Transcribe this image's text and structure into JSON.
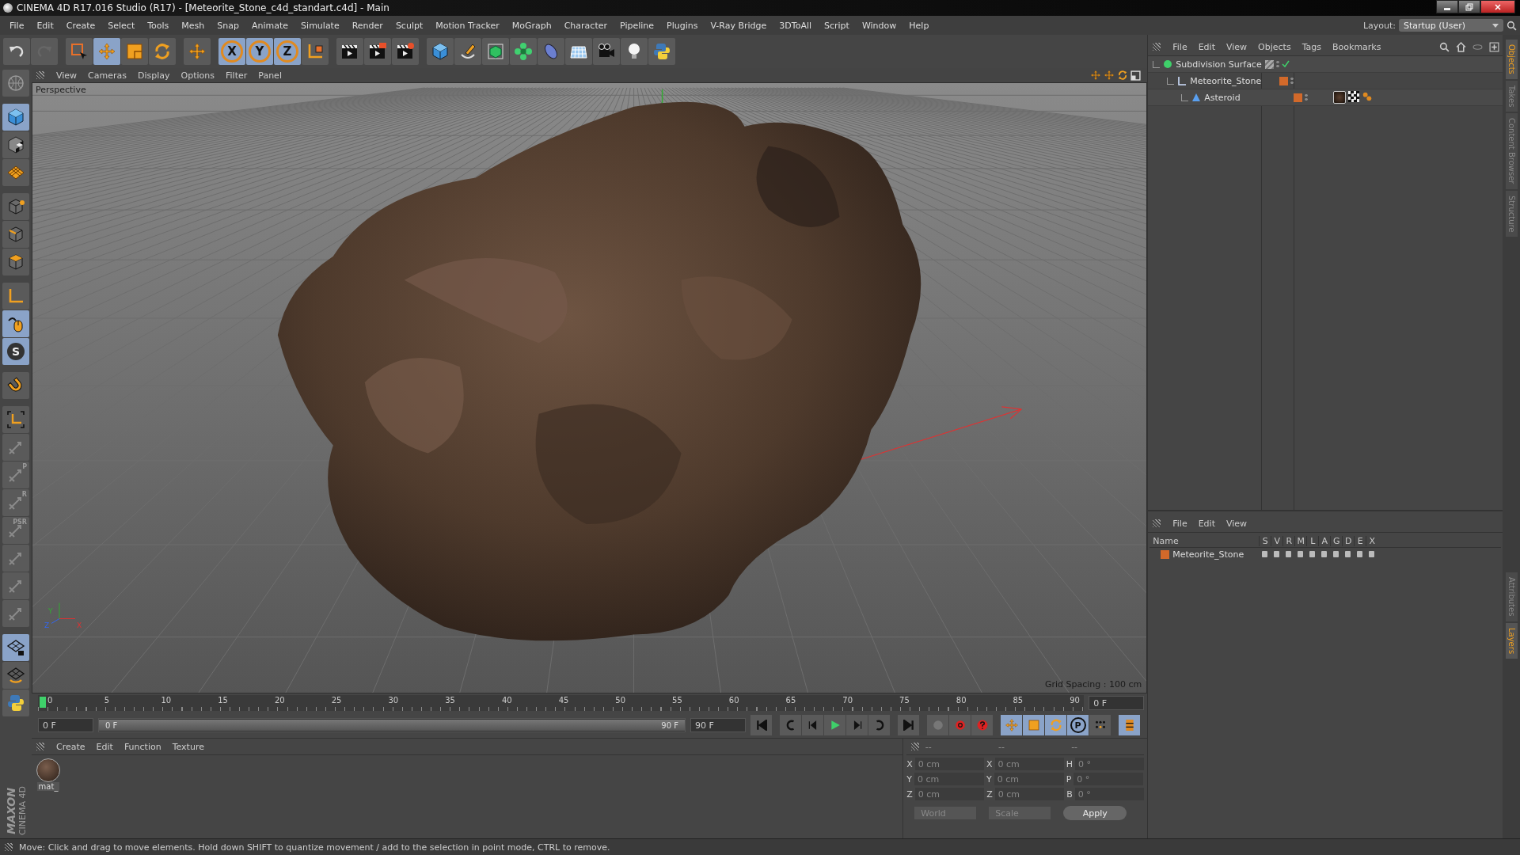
{
  "window": {
    "title": "CINEMA 4D R17.016 Studio (R17) - [Meteorite_Stone_c4d_standart.c4d] - Main"
  },
  "menu": [
    "File",
    "Edit",
    "Create",
    "Select",
    "Tools",
    "Mesh",
    "Snap",
    "Animate",
    "Simulate",
    "Render",
    "Sculpt",
    "Motion Tracker",
    "MoGraph",
    "Character",
    "Pipeline",
    "Plugins",
    "V-Ray Bridge",
    "3DToAll",
    "Script",
    "Window",
    "Help"
  ],
  "layout": {
    "label": "Layout:",
    "value": "Startup (User)"
  },
  "toolbar": [
    {
      "active": false
    },
    {
      "active": false
    },
    {
      "active": false
    },
    {
      "active": true
    },
    {
      "active": false
    },
    {
      "active": false
    },
    {
      "active": false
    },
    {
      "label": "X",
      "active": true
    },
    {
      "label": "Y",
      "active": true
    },
    {
      "label": "Z",
      "active": true
    },
    {
      "active": false
    },
    {
      "active": false
    },
    {
      "active": false
    },
    {
      "active": false
    },
    {
      "active": false
    },
    {
      "active": false
    },
    {
      "active": false
    },
    {
      "active": false
    },
    {
      "active": false
    },
    {
      "active": false
    },
    {
      "active": false
    },
    {
      "active": false
    },
    {
      "active": false
    }
  ],
  "left_tools": [
    {
      "active": false
    },
    {
      "active": true
    },
    {
      "active": false
    },
    {
      "active": false
    },
    {
      "active": false
    },
    {
      "active": false
    },
    {
      "active": false
    },
    {
      "active": false
    },
    {
      "active": true
    },
    {
      "label": "S",
      "active": true
    },
    {
      "active": false
    },
    {
      "active": false
    },
    {
      "active": false
    },
    {
      "label": "P",
      "active": false
    },
    {
      "label": "R",
      "active": false
    },
    {
      "label": "PSR",
      "active": false
    },
    {
      "active": false
    },
    {
      "active": false
    },
    {
      "active": false
    },
    {
      "active": true
    },
    {
      "active": false
    },
    {
      "active": false
    }
  ],
  "viewport": {
    "menu": [
      "View",
      "Cameras",
      "Display",
      "Options",
      "Filter",
      "Panel"
    ],
    "camera": "Perspective",
    "grid_spacing": "Grid Spacing : 100 cm",
    "axis_labels": [
      "Y",
      "Z",
      "X"
    ]
  },
  "object_manager": {
    "menu": [
      "File",
      "Edit",
      "View",
      "Objects",
      "Tags",
      "Bookmarks"
    ],
    "objects": [
      {
        "name": "Subdivision Surface",
        "enabled": true,
        "children": [
          {
            "name": "Meteorite_Stone",
            "color": "#d2692a",
            "children": [
              {
                "name": "Asteroid",
                "color": "#d2692a"
              }
            ]
          }
        ]
      }
    ]
  },
  "side_tabs": [
    {
      "label": "Objects",
      "selected": true
    },
    {
      "label": "Takes",
      "selected": false
    },
    {
      "label": "Content Browser",
      "selected": false
    },
    {
      "label": "Structure",
      "selected": false
    },
    {
      "label": "Attributes",
      "selected": false
    },
    {
      "label": "Layers",
      "selected": true
    }
  ],
  "layer_manager": {
    "menu": [
      "File",
      "Edit",
      "View"
    ],
    "columns": [
      "Name",
      "S",
      "V",
      "R",
      "M",
      "L",
      "A",
      "G",
      "D",
      "E",
      "X"
    ],
    "layers": [
      {
        "name": "Meteorite_Stone",
        "color": "#d2692a"
      }
    ]
  },
  "timeline": {
    "ticks": [
      "0",
      "5",
      "10",
      "15",
      "20",
      "25",
      "30",
      "35",
      "40",
      "45",
      "50",
      "55",
      "60",
      "65",
      "70",
      "75",
      "80",
      "85",
      "90"
    ],
    "level": 0,
    "current_frame": "0 F",
    "start_field": "0 F",
    "range": {
      "start": "0 F",
      "end": "90 F",
      "level": 1
    },
    "end_field": "90 F",
    "key_buttons": [
      {
        "active": true
      },
      {
        "active": true
      },
      {
        "active": true
      },
      {
        "label": "P",
        "active": true
      },
      {
        "active": false
      }
    ]
  },
  "material_manager": {
    "menu": [
      "Create",
      "Edit",
      "Function",
      "Texture"
    ],
    "materials": [
      {
        "name": "mat_"
      }
    ]
  },
  "coordinates": {
    "headers": [
      "--",
      "--",
      "--"
    ],
    "rows": [
      {
        "axis": "X",
        "position": "0 cm",
        "size_axis": "X",
        "size": "0 cm",
        "rot_axis": "H",
        "rotation": "0 °"
      },
      {
        "axis": "Y",
        "position": "0 cm",
        "size_axis": "Y",
        "size": "0 cm",
        "rot_axis": "P",
        "rotation": "0 °"
      },
      {
        "axis": "Z",
        "position": "0 cm",
        "size_axis": "Z",
        "size": "0 cm",
        "rot_axis": "B",
        "rotation": "0 °"
      }
    ],
    "mode": "World",
    "size_mode": "Scale",
    "apply": "Apply"
  },
  "logo": {
    "brand": "MAXON",
    "product": "CINEMA 4D"
  },
  "status_bar": "Move: Click and drag to move elements. Hold down SHIFT to quantize movement / add to the selection in point mode, CTRL to remove."
}
